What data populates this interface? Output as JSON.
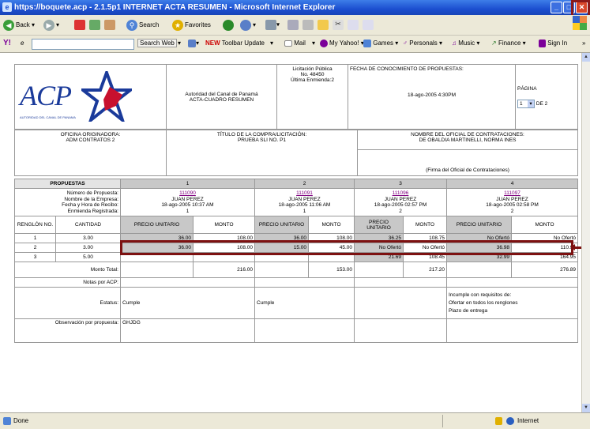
{
  "window": {
    "title": "https://boquete.acp - 2.1.5p1 INTERNET ACTA RESUMEN - Microsoft Internet Explorer"
  },
  "nav": {
    "back": "Back",
    "search": "Search",
    "favorites": "Favorites"
  },
  "toolbar": {
    "search_web": "Search Web",
    "toolbar_update": "Toolbar Update",
    "new_badge": "NEW",
    "mail": "Mail",
    "my_yahoo": "My Yahoo!",
    "games": "Games",
    "personals": "Personals",
    "music": "Music",
    "finance": "Finance",
    "sign_in": "Sign In",
    "yahoo": "Y!",
    "pencil": "e"
  },
  "doc": {
    "logo": "ACP",
    "logo_sub": "AUTORIDAD DEL CANAL DE PANAMA",
    "org": "Autoridad del Canal de Panamá",
    "acta": "ACTA-CUADRO RESUMEN",
    "licitacion": "Licitación Pública",
    "numero": "No. 48450",
    "enmienda": "Última Enmienda:2",
    "fecha_label": "FECHA DE CONOCIMIENTO DE PROPUESTAS:",
    "fecha_value": "18-ago-2005 4:30PM",
    "pagina_label": "PÁGINA",
    "pagina_value": "1",
    "pagina_de": "DE 2",
    "oficina_label": "OFICINA ORIGINADORA:",
    "oficina_value": "ADM CONTRATOS 2",
    "titulo_label": "TÍTULO DE LA COMPRA/LICITACIÓN:",
    "titulo_value": "PRUEBA SLI NO. P1",
    "oficial_label": "NOMBRE DEL OFICIAL DE CONTRATACIONES:",
    "oficial_value": "DE OBALDIA MARTINELLI, NORMA INES",
    "firma": "(Firma del Oficial de Contrataciones)"
  },
  "table": {
    "propuestas": "PROPUESTAS",
    "cols": [
      "1",
      "2",
      "3",
      "4"
    ],
    "row_labels": {
      "numero": "Número de Propuesta:",
      "empresa": "Nombre de la Empresa:",
      "fecha": "Fecha y Hora de Recibo:",
      "enmienda": "Enmienda Registrada:"
    },
    "proposals": [
      {
        "num": "111090",
        "empresa": "JUAN PEREZ",
        "fecha": "18-ago-2005 10:37 AM",
        "enm": "1"
      },
      {
        "num": "111091",
        "empresa": "JUAN PEREZ",
        "fecha": "18-ago-2005 11:06 AM",
        "enm": "1"
      },
      {
        "num": "111096",
        "empresa": "JUAN PEREZ",
        "fecha": "18-ago-2005 02:57 PM",
        "enm": "2"
      },
      {
        "num": "111097",
        "empresa": "JUAN PEREZ",
        "fecha": "18-ago-2005 02:58 PM",
        "enm": "2"
      }
    ],
    "renglon": "RENGLÓN NO.",
    "cantidad": "CANTIDAD",
    "precio": "PRECIO UNITARIO",
    "monto": "MONTO",
    "lines": [
      {
        "n": "1",
        "q": "3.00",
        "v": [
          "36.00",
          "108.00",
          "36.00",
          "108.00",
          "36.25",
          "108.75",
          "No Ofertó",
          "No Ofertó"
        ]
      },
      {
        "n": "2",
        "q": "3.00",
        "v": [
          "36.00",
          "108.00",
          "15.00",
          "45.00",
          "No Ofertó",
          "No Ofertó",
          "36.98",
          "110.94"
        ]
      },
      {
        "n": "3",
        "q": "5.00",
        "v": [
          "",
          "",
          "",
          "",
          "21.69",
          "108.45",
          "32.99",
          "164.95"
        ]
      }
    ],
    "monto_total": "Monto Total:",
    "totals": [
      "216.00",
      "153.00",
      "217.20",
      "276.89"
    ],
    "notas": "Notas por ACP:",
    "estatus": "Estatus:",
    "estatus_vals": [
      "Cumple",
      "Cumple",
      "",
      ""
    ],
    "incumple": [
      "Incumple con requisitos de:",
      "Ofertar en todos los renglones",
      "Plazo de entrega"
    ],
    "obs": "Observación por propuesta:",
    "obs_val": "GHJDG"
  },
  "status": {
    "done": "Done",
    "zone": "Internet"
  }
}
